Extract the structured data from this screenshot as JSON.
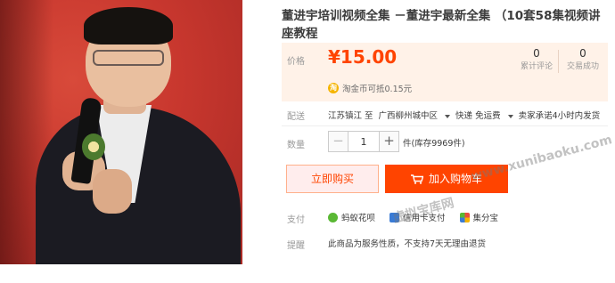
{
  "product": {
    "title": "董进宇培训视频全集 －董进宇最新全集 （10套58集视频讲座教程"
  },
  "price": {
    "label": "价格",
    "value": "¥15.00",
    "stats": [
      {
        "num": "0",
        "label": "累计评论"
      },
      {
        "num": "0",
        "label": "交易成功"
      }
    ],
    "coin_icon": "淘",
    "coin_text": "淘金币可抵0.15元"
  },
  "shipping": {
    "label": "配送",
    "from": "江苏镇江 至",
    "to": "广西柳州城中区",
    "method": "快递 免运费",
    "promise": "卖家承诺4小时内发货"
  },
  "quantity": {
    "label": "数量",
    "minus": "−",
    "value": "1",
    "plus": "+",
    "stock": "件(库存9969件)"
  },
  "actions": {
    "buy_now": "立即购买",
    "add_cart": "加入购物车"
  },
  "payment": {
    "label": "支付",
    "methods": [
      {
        "name": "蚂蚁花呗",
        "color": "#5ab834"
      },
      {
        "name": "信用卡支付",
        "color": "#3a7bd5"
      },
      {
        "name": "集分宝",
        "color": "#e94d3d"
      }
    ]
  },
  "notice": {
    "label": "提醒",
    "text": "此商品为服务性质，不支持7天无理由退货"
  },
  "watermarks": {
    "site_url": "www.xunibaoku.com",
    "site_name": "虚拟宝库网"
  },
  "colors": {
    "accent": "#ff4400",
    "price": "#ff4400",
    "price_bg": "#fff2e8"
  }
}
